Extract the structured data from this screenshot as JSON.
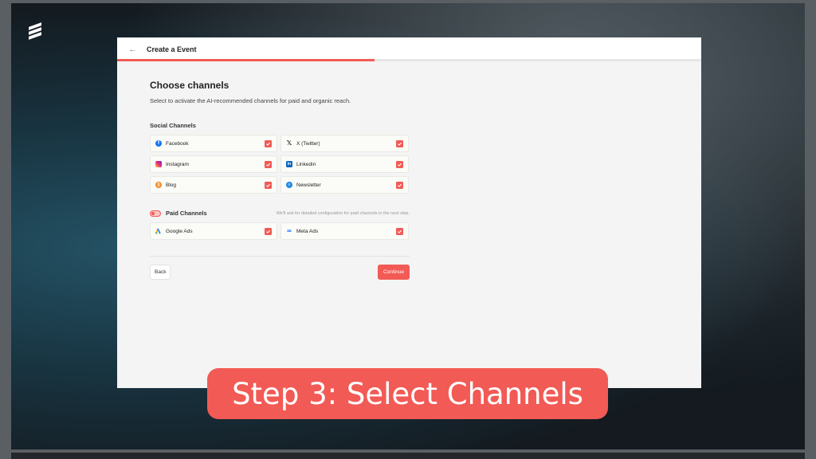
{
  "header": {
    "title": "Create a Event",
    "progress_percent": 44
  },
  "main": {
    "title": "Choose channels",
    "subtitle": "Select to activate the AI-recommended channels for paid and organic reach.",
    "social_section_label": "Social Channels",
    "social_channels": [
      {
        "label": "Facebook",
        "icon": "facebook-icon",
        "checked": true
      },
      {
        "label": "X (Twitter)",
        "icon": "x-twitter-icon",
        "checked": true
      },
      {
        "label": "Instagram",
        "icon": "instagram-icon",
        "checked": true
      },
      {
        "label": "Linkedin",
        "icon": "linkedin-icon",
        "checked": true
      },
      {
        "label": "Blog",
        "icon": "rss-icon",
        "checked": true
      },
      {
        "label": "Newsletter",
        "icon": "newsletter-icon",
        "checked": true
      }
    ],
    "paid_section_label": "Paid Channels",
    "paid_toggle_on": true,
    "paid_note": "We'll ask for detailed configuration for paid channels in the next step.",
    "paid_channels": [
      {
        "label": "Google Ads",
        "icon": "google-ads-icon",
        "checked": true
      },
      {
        "label": "Meta Ads",
        "icon": "meta-icon",
        "checked": true
      }
    ],
    "back_label": "Back",
    "continue_label": "Continue"
  },
  "caption": "Step 3: Select Channels",
  "colors": {
    "accent": "#f25a55",
    "window_bg": "#f4f4f4"
  }
}
